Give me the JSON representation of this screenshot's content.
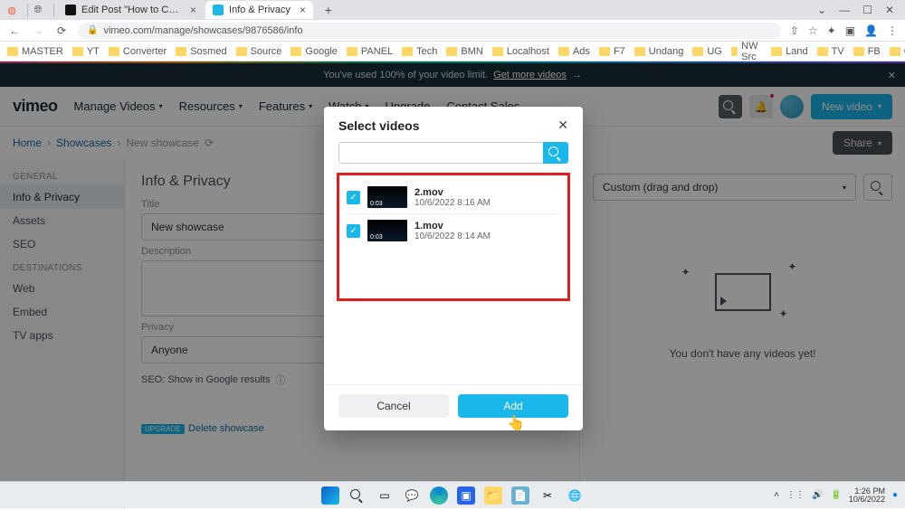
{
  "browser": {
    "tabs": [
      {
        "title": "Edit Post \"How to Create a Playli..."
      },
      {
        "title": "Info & Privacy"
      }
    ],
    "url": "vimeo.com/manage/showcases/9876586/info",
    "bookmarks": [
      "MASTER",
      "YT",
      "Converter",
      "Sosmed",
      "Source",
      "Google",
      "PANEL",
      "Tech",
      "BMN",
      "Localhost",
      "Ads",
      "F7",
      "Undang",
      "UG",
      "NW Src",
      "Land",
      "TV",
      "FB",
      "Gov"
    ]
  },
  "banner": {
    "text": "You've used 100% of your video limit.",
    "link": "Get more videos",
    "arrow": "→"
  },
  "nav": {
    "logo": "vimeo",
    "menu": [
      "Manage Videos",
      "Resources",
      "Features",
      "Watch",
      "Upgrade",
      "Contact Sales"
    ],
    "newvideo": "New video"
  },
  "crumbs": {
    "a": "Home",
    "b": "Showcases",
    "c": "New showcase",
    "share": "Share"
  },
  "sidebar": {
    "g1": "GENERAL",
    "g2": "DESTINATIONS",
    "items1": [
      "Info & Privacy",
      "Assets",
      "SEO"
    ],
    "items2": [
      "Web",
      "Embed",
      "TV apps"
    ]
  },
  "form": {
    "title": "Info & Privacy",
    "title_label": "Title",
    "title_value": "New showcase",
    "desc_label": "Description",
    "privacy_label": "Privacy",
    "privacy_value": "Anyone",
    "seo_label": "SEO: Show in Google results",
    "upgrade": "UPGRADE",
    "delete": "Delete showcase"
  },
  "rightcol": {
    "sort": "Custom (drag and drop)",
    "empty": "You don't have any videos yet!"
  },
  "modal": {
    "title": "Select videos",
    "videos": [
      {
        "name": "2.mov",
        "date": "10/6/2022 8:16 AM",
        "dur": "0:03"
      },
      {
        "name": "1.mov",
        "date": "10/6/2022 8:14 AM",
        "dur": "0:03"
      }
    ],
    "cancel": "Cancel",
    "add": "Add"
  },
  "taskbar": {
    "time": "1:26 PM",
    "date": "10/6/2022"
  }
}
